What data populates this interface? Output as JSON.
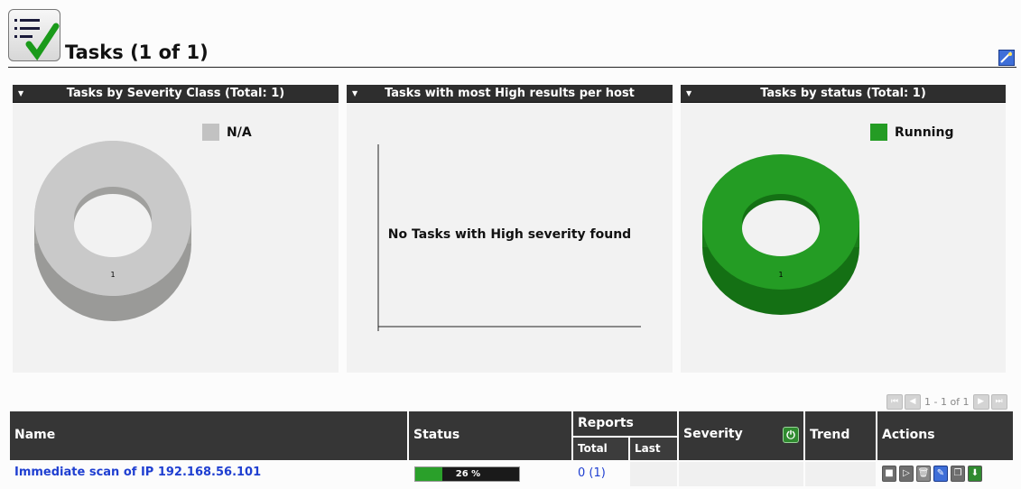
{
  "page": {
    "title": "Tasks (1 of 1)",
    "icon": "tasks-checklist-icon"
  },
  "panels": [
    {
      "title": "Tasks by Severity Class (Total: 1)",
      "legend": [
        {
          "label": "N/A",
          "color": "#c2c2c2"
        }
      ],
      "donut_label": "1"
    },
    {
      "title": "Tasks with most High results per host",
      "message": "No Tasks with High severity found"
    },
    {
      "title": "Tasks by status (Total: 1)",
      "legend": [
        {
          "label": "Running",
          "color": "#249c24"
        }
      ],
      "donut_label": "1"
    }
  ],
  "chart_data": [
    {
      "type": "pie",
      "title": "Tasks by Severity Class (Total: 1)",
      "categories": [
        "N/A"
      ],
      "values": [
        1
      ],
      "colors": [
        "#c2c2c2"
      ],
      "legend": "top-right"
    },
    {
      "type": "bar",
      "title": "Tasks with most High results per host",
      "categories": [],
      "values": []
    },
    {
      "type": "pie",
      "title": "Tasks by status (Total: 1)",
      "categories": [
        "Running"
      ],
      "values": [
        1
      ],
      "colors": [
        "#249c24"
      ],
      "legend": "top-right"
    }
  ],
  "pagination": {
    "text": "1 - 1 of 1"
  },
  "table": {
    "headers": {
      "name": "Name",
      "status": "Status",
      "reports": "Reports",
      "reports_total": "Total",
      "reports_last": "Last",
      "severity": "Severity",
      "trend": "Trend",
      "actions": "Actions"
    },
    "rows": [
      {
        "name": "Immediate scan of IP 192.168.56.101",
        "status": "26 %",
        "progress": 0.26,
        "reports_total": "0",
        "reports_total_paren": "(1)",
        "reports_last": "",
        "severity": "",
        "trend": ""
      }
    ]
  },
  "actions": [
    "stop-icon",
    "resume-icon",
    "trashcan-icon",
    "edit-icon",
    "clone-icon",
    "export-icon"
  ],
  "colors": {
    "header_bg": "#363636",
    "link": "#1f3fd1",
    "running": "#249c24",
    "na": "#c2c2c2"
  }
}
